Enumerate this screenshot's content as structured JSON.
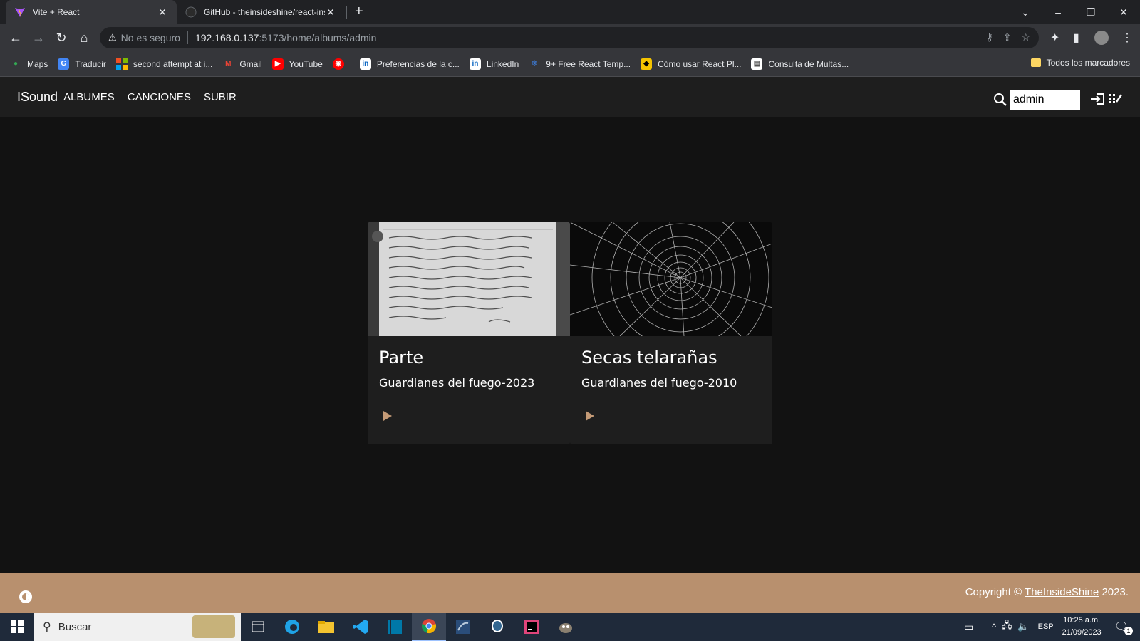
{
  "browser": {
    "tabs": [
      {
        "title": "Vite + React",
        "active": true
      },
      {
        "title": "GitHub - theinsideshine/react-ins",
        "active": false
      }
    ],
    "address": {
      "security": "No es seguro",
      "host": "192.168.0.137",
      "path": ":5173/home/albums/admin"
    },
    "bookmarks": [
      {
        "label": "Maps",
        "icon": "maps-icon",
        "color": "#34a853"
      },
      {
        "label": "Traducir",
        "icon": "translate-icon",
        "color": "#4285f4"
      },
      {
        "label": "second attempt at i...",
        "icon": "microsoft-icon",
        "color": "#f25022"
      },
      {
        "label": "Gmail",
        "icon": "gmail-icon",
        "color": "#ea4335"
      },
      {
        "label": "YouTube",
        "icon": "youtube-icon",
        "color": "#ff0000"
      },
      {
        "label": "",
        "icon": "youtube-music-icon",
        "color": "#ff0000"
      },
      {
        "label": "Preferencias de la c...",
        "icon": "linkedin-icon",
        "color": "#0a66c2"
      },
      {
        "label": "LinkedIn",
        "icon": "linkedin-icon",
        "color": "#0a66c2"
      },
      {
        "label": "9+ Free React Temp...",
        "icon": "react-icon",
        "color": "#3d7bd6"
      },
      {
        "label": "Cómo usar React Pl...",
        "icon": "cat-icon",
        "color": "#f5c400"
      },
      {
        "label": "Consulta de Multas...",
        "icon": "document-icon",
        "color": "#ffffff"
      }
    ],
    "bookmarks_all": "Todos los marcadores"
  },
  "app": {
    "brand": "ISound",
    "nav": [
      "ALBUMES",
      "CANCIONES",
      "SUBIR"
    ],
    "search_value": "admin",
    "albums": [
      {
        "title": "Parte",
        "subtitle": "Guardianes del fuego-2023",
        "image": "handwritten-notebook"
      },
      {
        "title": "Secas telarañas",
        "subtitle": "Guardianes del fuego-2010",
        "image": "spider-web"
      }
    ],
    "footer": {
      "prefix": "Copyright © ",
      "link": "TheInsideShine",
      "suffix": " 2023."
    },
    "accent": "#b8906e"
  },
  "taskbar": {
    "search_placeholder": "Buscar",
    "lang": "ESP",
    "time": "10:25 a.m.",
    "date": "21/09/2023",
    "notifications": "1"
  }
}
